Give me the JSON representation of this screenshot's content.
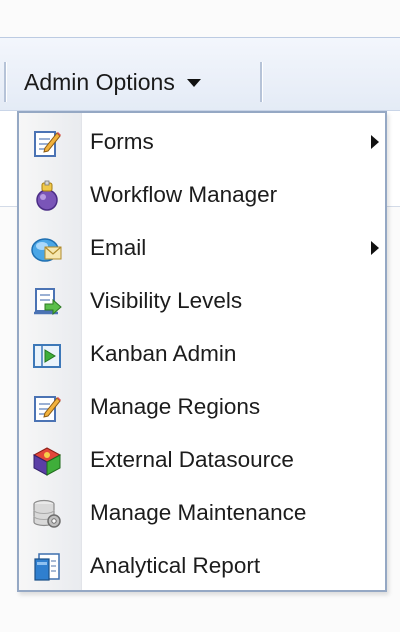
{
  "toolbar": {
    "menu_label": "Admin Options"
  },
  "menu": {
    "items": [
      {
        "label": "Forms",
        "icon": "form-edit-icon",
        "has_submenu": true
      },
      {
        "label": "Workflow Manager",
        "icon": "workflow-icon",
        "has_submenu": false
      },
      {
        "label": "Email",
        "icon": "email-icon",
        "has_submenu": true
      },
      {
        "label": "Visibility Levels",
        "icon": "visibility-icon",
        "has_submenu": false
      },
      {
        "label": "Kanban Admin",
        "icon": "kanban-icon",
        "has_submenu": false
      },
      {
        "label": "Manage Regions",
        "icon": "regions-edit-icon",
        "has_submenu": false
      },
      {
        "label": "External Datasource",
        "icon": "datasource-icon",
        "has_submenu": false
      },
      {
        "label": "Manage Maintenance",
        "icon": "maintenance-icon",
        "has_submenu": false
      },
      {
        "label": "Analytical Report",
        "icon": "report-icon",
        "has_submenu": false
      }
    ]
  }
}
